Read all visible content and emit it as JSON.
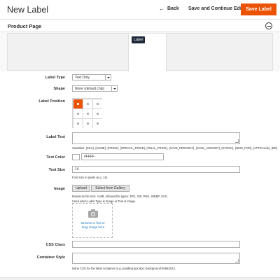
{
  "header": {
    "title": "New Label",
    "back_label": "Back",
    "save_continue_label": "Save and Continue Edit",
    "save_label": "Save Label"
  },
  "section": {
    "title": "Product Page"
  },
  "preview": {
    "label_text": "Label"
  },
  "form": {
    "label_type": {
      "label": "Label Type",
      "value": "Text Only"
    },
    "shape": {
      "label": "Shape",
      "value": "None (default chip)"
    },
    "label_position": {
      "label": "Label Position",
      "selected_index": 0
    },
    "label_text": {
      "label": "Label Text",
      "value": "",
      "note": "Variables: {SKU}, {NAME}, {PRICE}, {SPECIAL_PRICE}, {FINAL_PRICE}, {SAVE_PERCENT}, {SAVE_AMOUNT}, {STOCK}, {NEW_FOR}, {ATTR:code}, {BR}"
    },
    "text_color": {
      "label": "Text Color",
      "value": "#FFFF"
    },
    "text_size": {
      "label": "Text Size",
      "value": "14",
      "note": "Font size in pixels (e.g. 14)."
    },
    "image": {
      "label": "Image",
      "upload_label": "Upload",
      "gallery_label": "Select from Gallery",
      "note1": "Maximum file size: 4 MB. Allowed file types: JPG, GIF, PNG, WEBP, SVG.",
      "note2": "Used when Label Type is Image or Text & Image.",
      "drop_text_1": "Browse to find or",
      "drop_text_2": "drag image here"
    },
    "css_class": {
      "label": "CSS Class",
      "value": ""
    },
    "container_style": {
      "label": "Container Style",
      "value": "",
      "note": "Inline CSS for the label container (e.g. padding:4px 8px; background:#eb5202;)."
    }
  },
  "colors": {
    "accent": "#eb5202",
    "link": "#1979c3",
    "label_bg": "#1e2a3a"
  }
}
